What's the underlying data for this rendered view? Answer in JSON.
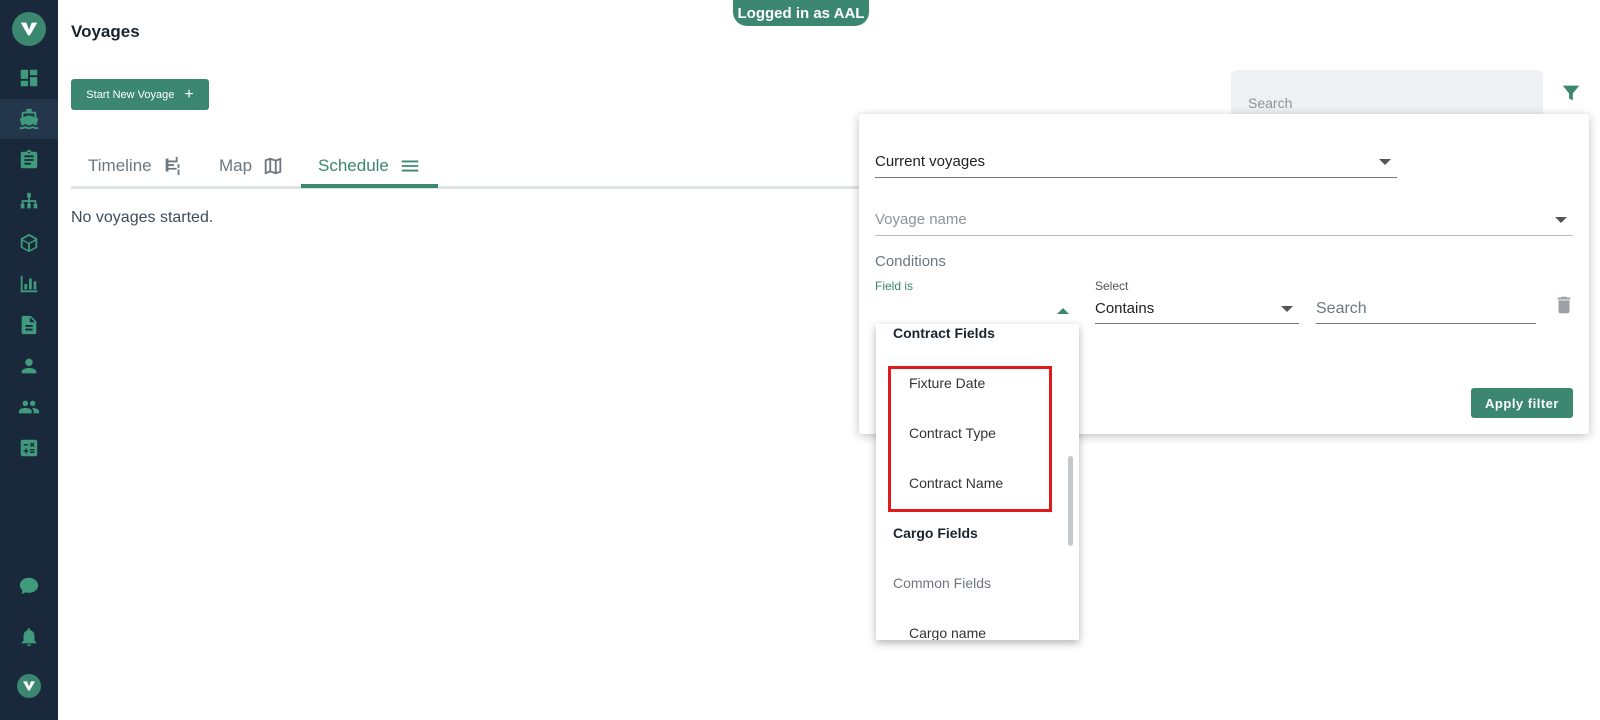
{
  "app": {
    "login_badge": "Logged in as AAL",
    "page_title": "Voyages",
    "start_button": "Start New Voyage",
    "start_button_icon": "+"
  },
  "sidebar": {
    "items": [
      {
        "name": "dashboard",
        "icon": "dashboard-icon"
      },
      {
        "name": "voyages",
        "icon": "ship-icon",
        "active": true
      },
      {
        "name": "contracts",
        "icon": "clipboard-icon"
      },
      {
        "name": "hierarchy",
        "icon": "sitemap-icon"
      },
      {
        "name": "cargo",
        "icon": "cube-icon"
      },
      {
        "name": "reports",
        "icon": "bar-chart-icon"
      },
      {
        "name": "documents",
        "icon": "document-icon"
      },
      {
        "name": "user",
        "icon": "person-icon"
      },
      {
        "name": "users",
        "icon": "people-icon"
      },
      {
        "name": "calculator",
        "icon": "calculator-icon"
      },
      {
        "name": "chat",
        "icon": "chat-icon"
      },
      {
        "name": "notifications",
        "icon": "bell-icon"
      }
    ]
  },
  "search": {
    "placeholder": "Search"
  },
  "tabs": [
    {
      "label": "Timeline",
      "icon": "timeline-icon"
    },
    {
      "label": "Map",
      "icon": "map-icon"
    },
    {
      "label": "Schedule",
      "icon": "list-icon",
      "active": true
    }
  ],
  "main": {
    "empty_text": "No voyages started."
  },
  "filter_panel": {
    "scope_value": "Current voyages",
    "voyage_name_placeholder": "Voyage name",
    "conditions_label": "Conditions",
    "field_is_label": "Field is",
    "select_label": "Select",
    "operator_value": "Contains",
    "search_placeholder": "Search",
    "apply_label": "Apply filter"
  },
  "dropdown": {
    "items": [
      {
        "label": "Contract Fields",
        "kind": "group"
      },
      {
        "label": "Fixture Date",
        "kind": "option"
      },
      {
        "label": "Contract Type",
        "kind": "option"
      },
      {
        "label": "Contract Name",
        "kind": "option"
      },
      {
        "label": "Cargo Fields",
        "kind": "group"
      },
      {
        "label": "Common Fields",
        "kind": "subgroup"
      },
      {
        "label": "Cargo name",
        "kind": "option"
      }
    ]
  },
  "colors": {
    "accent": "#3b8770",
    "sidebar_bg": "#19283a",
    "highlight": "#e01b1b"
  }
}
